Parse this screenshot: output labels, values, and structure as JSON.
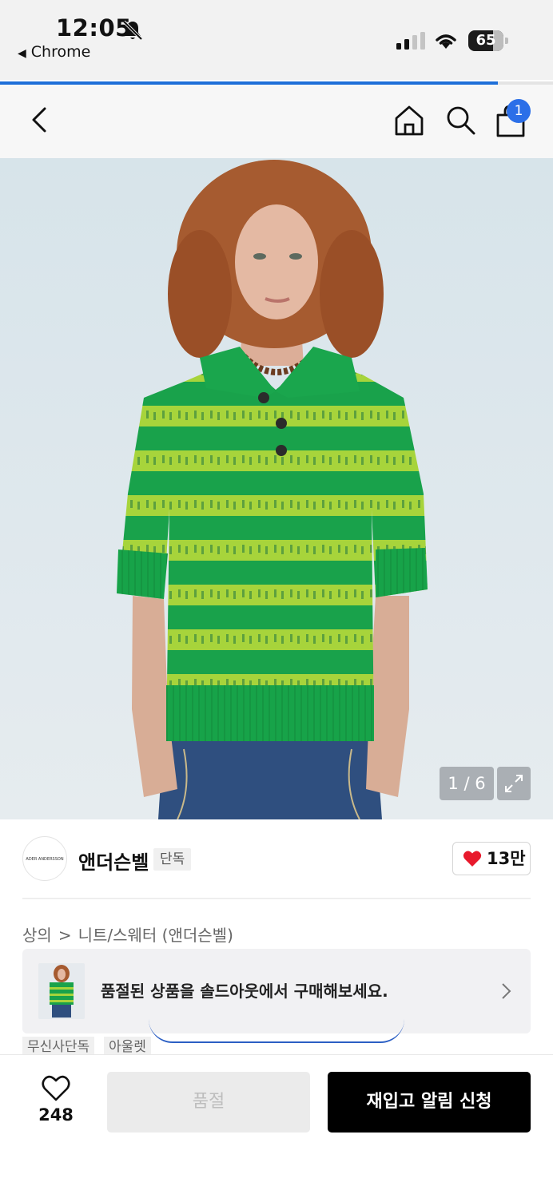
{
  "status_bar": {
    "time": "12:05",
    "back_app": "Chrome",
    "battery": "65",
    "icons": [
      "bell-slash-icon",
      "signal-icon",
      "wifi-icon",
      "battery-icon"
    ]
  },
  "page_load_progress": 0.9,
  "nav": {
    "icons": [
      "back-icon",
      "home-icon",
      "search-icon",
      "cart-icon"
    ],
    "cart_badge": "1"
  },
  "gallery": {
    "counter": "1 / 6",
    "expand_icon": "expand-icon"
  },
  "brand": {
    "logo_text": "ADER ANDERSSON BELL",
    "name": "앤더슨벨",
    "tag": "단독",
    "like_count": "13만"
  },
  "breadcrumb": {
    "level1": "상의",
    "separator": ">",
    "level2": "니트/스웨터 (앤더슨벨)"
  },
  "soldout_banner": {
    "text": "품절된 상품을 솔드아웃에서 구매해보세요."
  },
  "chips": [
    "무신사단독",
    "아울렛"
  ],
  "bottom_bar": {
    "wish_count": "248",
    "soldout_label": "품절",
    "restock_label": "재입고 알림 신청"
  },
  "colors": {
    "accent_blue": "#2b6fe8",
    "heart_red": "#e8192c",
    "sweater_green": "#18a34a",
    "stripe_lime": "#a9d63a"
  }
}
